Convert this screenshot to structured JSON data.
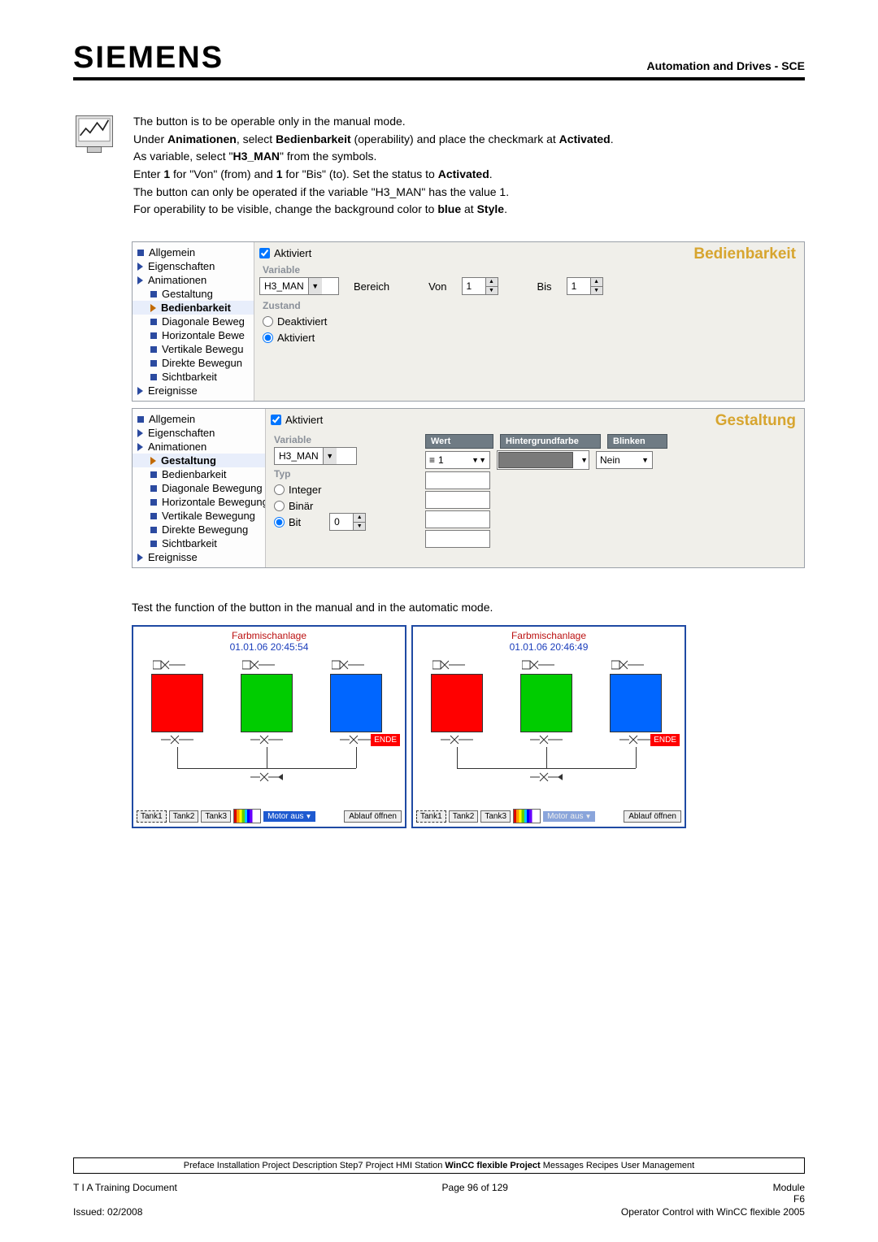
{
  "header": {
    "logo": "SIEMENS",
    "right": "Automation and Drives - SCE"
  },
  "intro": {
    "p1": "The button is to be operable only in the manual mode.",
    "p2a": "Under ",
    "p2b": "Animationen",
    "p2c": ", select ",
    "p2d": "Bedienbarkeit",
    "p2e": " (operability) and place the checkmark at ",
    "p2f": "Activated",
    "p2g": ".",
    "p3a": "As variable, select \"",
    "p3b": "H3_MAN",
    "p3c": "\" from the symbols.",
    "p4a": "Enter ",
    "p4b": "1",
    "p4c": " for \"Von\" (from) and ",
    "p4d": "1",
    "p4e": " for \"Bis\" (to). Set the status to ",
    "p4f": "Activated",
    "p4g": ".",
    "p5": "The button can only be operated if the variable \"H3_MAN\" has the value 1.",
    "p6a": "For operability to be visible, change the background color to ",
    "p6b": "blue",
    "p6c": " at ",
    "p6d": "Style",
    "p6e": "."
  },
  "tree1": {
    "allgemein": "Allgemein",
    "eigenschaften": "Eigenschaften",
    "animationen": "Animationen",
    "gestaltung": "Gestaltung",
    "bedienbarkeit": "Bedienbarkeit",
    "diag": "Diagonale Beweg",
    "horiz": "Horizontale Bewe",
    "vert": "Vertikale Bewegu",
    "direkt": "Direkte Bewegun",
    "sicht": "Sichtbarkeit",
    "ereignisse": "Ereignisse"
  },
  "panel1": {
    "title": "Bedienbarkeit",
    "activated": "Aktiviert",
    "var_label": "Variable",
    "var_value": "H3_MAN",
    "range_label": "Bereich",
    "von_label": "Von",
    "von_value": "1",
    "bis_label": "Bis",
    "bis_value": "1",
    "zustand_label": "Zustand",
    "deaktiviert": "Deaktiviert",
    "aktiviert": "Aktiviert"
  },
  "tree2": {
    "allgemein": "Allgemein",
    "eigenschaften": "Eigenschaften",
    "animationen": "Animationen",
    "gestaltung": "Gestaltung",
    "bedienbarkeit": "Bedienbarkeit",
    "diag": "Diagonale Bewegung",
    "horiz": "Horizontale Bewegung",
    "vert": "Vertikale Bewegung",
    "direkt": "Direkte Bewegung",
    "sicht": "Sichtbarkeit",
    "ereignisse": "Ereignisse"
  },
  "panel2": {
    "title": "Gestaltung",
    "activated": "Aktiviert",
    "var_label": "Variable",
    "var_value": "H3_MAN",
    "typ_label": "Typ",
    "integer": "Integer",
    "binar": "Binär",
    "bit": "Bit",
    "bit_value": "0",
    "col_wert": "Wert",
    "col_hinter": "Hintergrundfarbe",
    "col_blinken": "Blinken",
    "wert_value": "1",
    "blinken_value": "Nein"
  },
  "test_note": "Test the function of the button in the manual and in the automatic mode.",
  "hmi": {
    "title": "Farbmischanlage",
    "time1": "01.01.06 20:45:54",
    "time2": "01.01.06 20:46:49",
    "ende": "ENDE",
    "tank1": "Tank1",
    "tank2": "Tank2",
    "tank3": "Tank3",
    "motor": "Motor aus",
    "ablauf": "Ablauf öffnen"
  },
  "footer": {
    "box_a": "Preface Installation Project Description Step7 Project HMI Station ",
    "box_b": "WinCC flexible Project",
    "box_c": " Messages Recipes User Management",
    "left": "T I A  Training Document",
    "center": "Page 96 of 129",
    "right1": "Module",
    "right2": "F6",
    "issued": "Issued: 02/2008",
    "bottom_right": "Operator Control with WinCC flexible 2005"
  }
}
